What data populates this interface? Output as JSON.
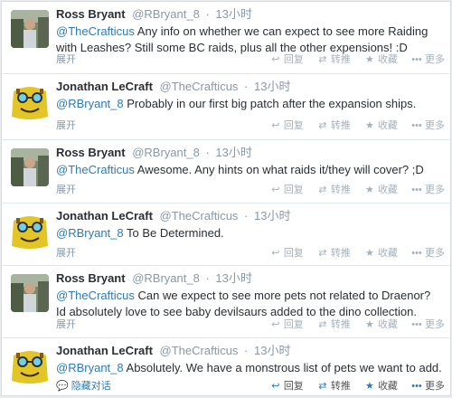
{
  "tweets": [
    {
      "name": "Ross Bryant",
      "handle": "@RBryant_8",
      "sep": "·",
      "time": "13小时",
      "mention": "@TheCrafticus",
      "text": " Any info on whether we can expect to see more Raiding with Leashes? Still some BC raids, plus all the other expensions! :D",
      "expand": "展开",
      "actions": {
        "reply": "回复",
        "retweet": "转推",
        "favorite": "收藏",
        "more": "更多"
      }
    },
    {
      "name": "Jonathan LeCraft",
      "handle": "@TheCrafticus",
      "sep": "·",
      "time": "13小时",
      "mention": "@RBryant_8",
      "text": " Probably in our first big patch after the expansion ships.",
      "expand": "展开",
      "actions": {
        "reply": "回复",
        "retweet": "转推",
        "favorite": "收藏",
        "more": "更多"
      }
    },
    {
      "name": "Ross Bryant",
      "handle": "@RBryant_8",
      "sep": "·",
      "time": "13小时",
      "mention": "@TheCrafticus",
      "text": " Awesome. Any hints on what raids it/they will cover? ;D",
      "expand": "展开",
      "actions": {
        "reply": "回复",
        "retweet": "转推",
        "favorite": "收藏",
        "more": "更多"
      }
    },
    {
      "name": "Jonathan LeCraft",
      "handle": "@TheCrafticus",
      "sep": "·",
      "time": "13小时",
      "mention": "@RBryant_8",
      "text": " To Be Determined.",
      "expand": "展开",
      "actions": {
        "reply": "回复",
        "retweet": "转推",
        "favorite": "收藏",
        "more": "更多"
      }
    },
    {
      "name": "Ross Bryant",
      "handle": "@RBryant_8",
      "sep": "·",
      "time": "13小时",
      "mention": "@TheCrafticus",
      "text": " Can we expect to see more pets not related to Draenor? Id absolutely love to see baby devilsaurs added to the dino collection.",
      "expand": "展开",
      "actions": {
        "reply": "回复",
        "retweet": "转推",
        "favorite": "收藏",
        "more": "更多"
      }
    },
    {
      "name": "Jonathan LeCraft",
      "handle": "@TheCrafticus",
      "sep": "·",
      "time": "13小时",
      "mention": "@RBryant_8",
      "text": " Absolutely.  We have a monstrous list of pets we want to add.",
      "expand": "隐藏对话",
      "actions": {
        "reply": "回复",
        "retweet": "转推",
        "favorite": "收藏",
        "more": "更多"
      }
    }
  ],
  "colors": {
    "link": "#2b7bb9",
    "muted": "#8899a6",
    "text": "#292f33"
  }
}
